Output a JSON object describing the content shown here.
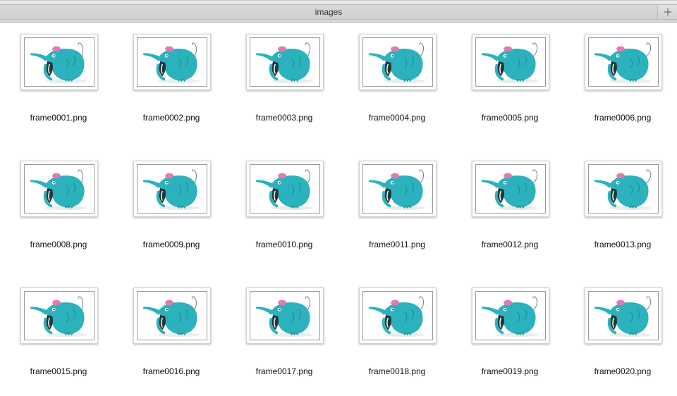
{
  "window": {
    "tab_title": "images",
    "new_tab_icon": "plus-icon"
  },
  "colors": {
    "creature_body": "#2bb2bd",
    "creature_dark": "#1d8f99",
    "hat": "#e07ab4",
    "mouth": "#20363b"
  },
  "files": [
    {
      "name": "frame0001.png"
    },
    {
      "name": "frame0002.png"
    },
    {
      "name": "frame0003.png"
    },
    {
      "name": "frame0004.png"
    },
    {
      "name": "frame0005.png"
    },
    {
      "name": "frame0006.png"
    },
    {
      "name": "frame0008.png"
    },
    {
      "name": "frame0009.png"
    },
    {
      "name": "frame0010.png"
    },
    {
      "name": "frame0011.png"
    },
    {
      "name": "frame0012.png"
    },
    {
      "name": "frame0013.png"
    },
    {
      "name": "frame0015.png"
    },
    {
      "name": "frame0016.png"
    },
    {
      "name": "frame0017.png"
    },
    {
      "name": "frame0018.png"
    },
    {
      "name": "frame0019.png"
    },
    {
      "name": "frame0020.png"
    }
  ]
}
